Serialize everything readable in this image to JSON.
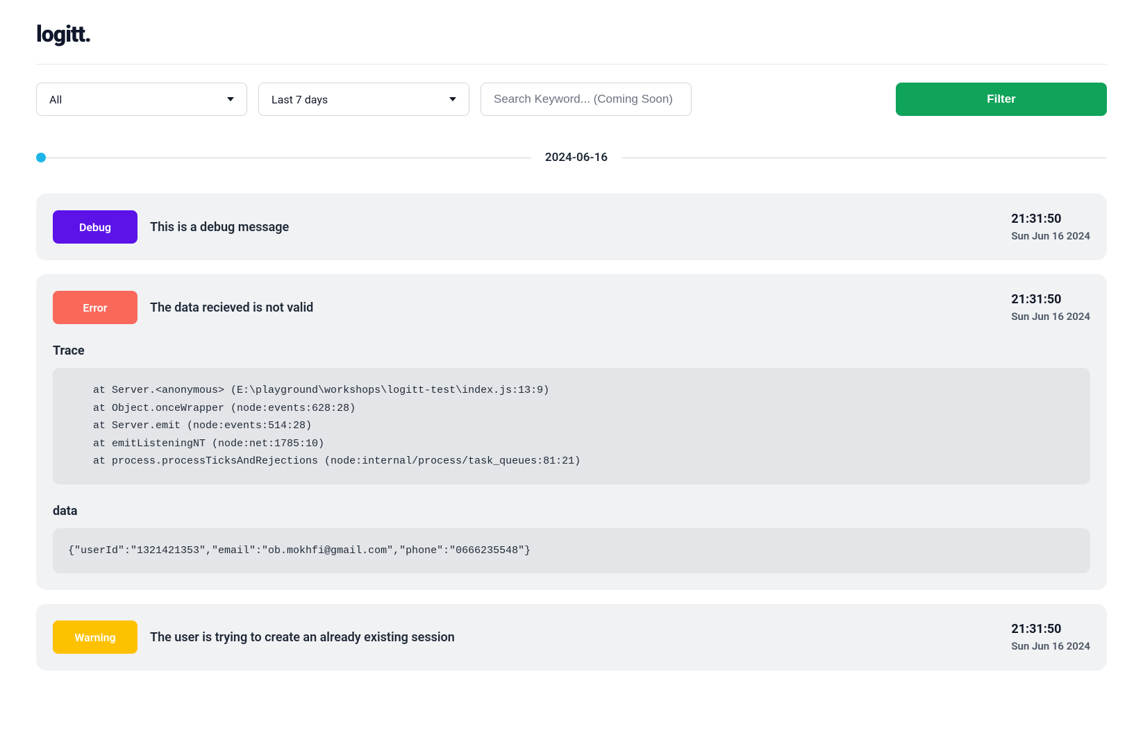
{
  "brand": {
    "name": "logitt",
    "dot": "."
  },
  "filters": {
    "type_selected": "All",
    "range_selected": "Last 7 days",
    "search_placeholder": "Search Keyword... (Coming Soon)",
    "filter_button": "Filter"
  },
  "date_group": "2024-06-16",
  "logs": [
    {
      "level": "Debug",
      "badge_class": "badge-debug",
      "message": "This is a debug message",
      "time": "21:31:50",
      "date": "Sun Jun 16 2024"
    },
    {
      "level": "Error",
      "badge_class": "badge-error",
      "message": "The data recieved is not valid",
      "time": "21:31:50",
      "date": "Sun Jun 16 2024",
      "trace_label": "Trace",
      "trace": "    at Server.<anonymous> (E:\\playground\\workshops\\logitt-test\\index.js:13:9)\n    at Object.onceWrapper (node:events:628:28)\n    at Server.emit (node:events:514:28)\n    at emitListeningNT (node:net:1785:10)\n    at process.processTicksAndRejections (node:internal/process/task_queues:81:21)",
      "data_label": "data",
      "data": "{\"userId\":\"1321421353\",\"email\":\"ob.mokhfi@gmail.com\",\"phone\":\"0666235548\"}"
    },
    {
      "level": "Warning",
      "badge_class": "badge-warning",
      "message": "The user is trying to create an already existing session",
      "time": "21:31:50",
      "date": "Sun Jun 16 2024"
    }
  ]
}
